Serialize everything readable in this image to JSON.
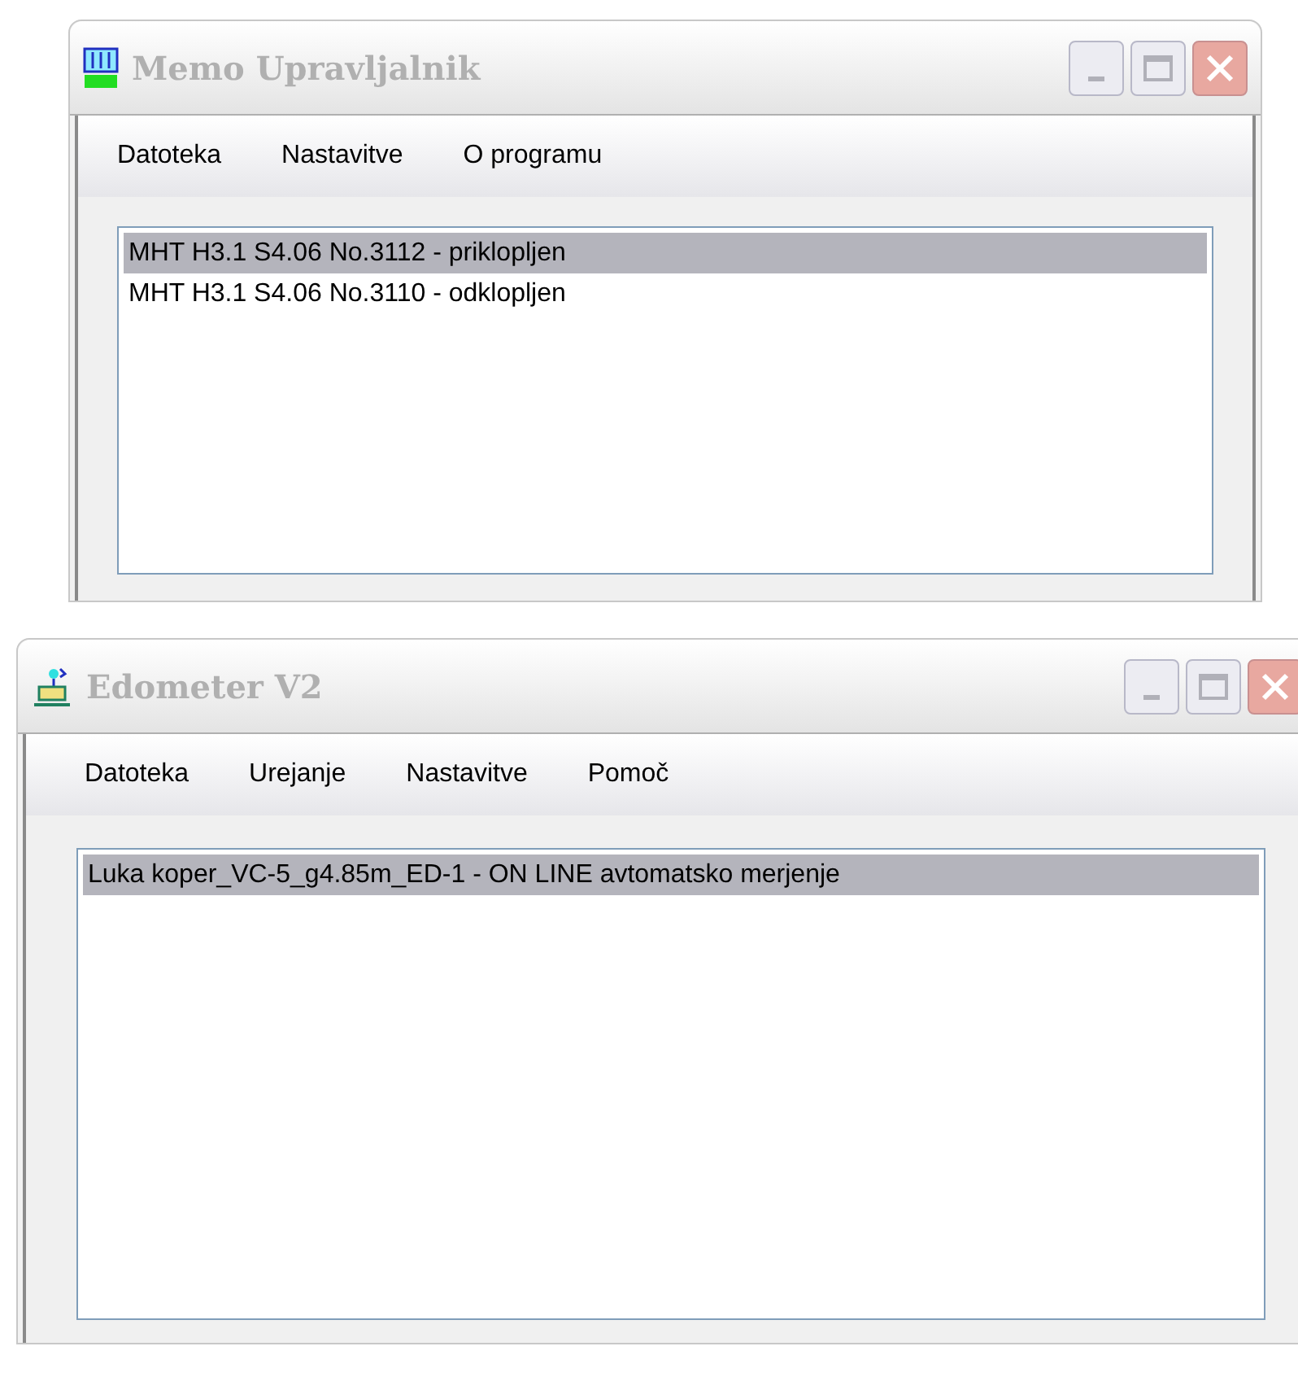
{
  "windows": [
    {
      "title": "Memo Upravljalnik",
      "menu": [
        "Datoteka",
        "Nastavitve",
        "O programu"
      ],
      "items": [
        {
          "label": "MHT H3.1 S4.06 No.3112 - priklopljen",
          "selected": true
        },
        {
          "label": "MHT H3.1 S4.06 No.3110 - odklopljen",
          "selected": false
        }
      ]
    },
    {
      "title": "Edometer V2",
      "menu": [
        "Datoteka",
        "Urejanje",
        "Nastavitve",
        "Pomoč"
      ],
      "items": [
        {
          "label": "Luka koper_VC-5_g4.85m_ED-1 - ON LINE avtomatsko merjenje",
          "selected": true
        }
      ]
    }
  ]
}
